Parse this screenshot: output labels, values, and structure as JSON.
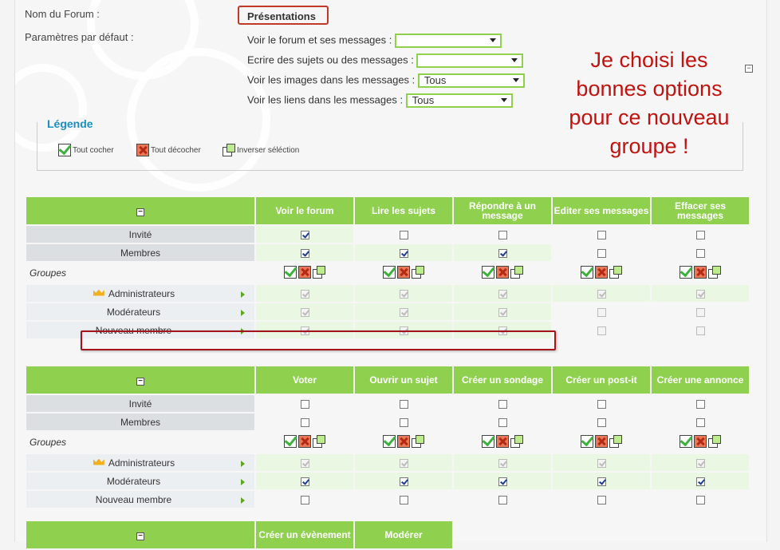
{
  "colors": {
    "accent": "#8fd14f",
    "annotation": "#c0120f",
    "legend_title": "#1a8fc4"
  },
  "form": {
    "forum_name_label": "Nom du Forum :",
    "forum_name_value": "Présentations",
    "defaults_label": "Paramètres par défaut :",
    "opt_view": {
      "label": "Voir le forum et ses messages :",
      "value": ""
    },
    "opt_write": {
      "label": "Ecrire des sujets ou des messages :",
      "value": ""
    },
    "opt_images": {
      "label": "Voir les images dans les messages :",
      "value": "Tous"
    },
    "opt_links": {
      "label": "Voir les liens dans les messages :",
      "value": "Tous"
    }
  },
  "annotation": [
    "Je choisi les",
    "bonnes options",
    "pour ce nouveau",
    "groupe !"
  ],
  "legend": {
    "title": "Légende",
    "check_all": "Tout cocher",
    "uncheck_all": "Tout décocher",
    "invert": "Inverser séléction"
  },
  "collapse_symbol": "−",
  "rows": {
    "invite": "Invité",
    "membres": "Membres",
    "groupes": "Groupes",
    "admins": "Administrateurs",
    "mods": "Modérateurs",
    "nouveau": "Nouveau membre"
  },
  "table1": {
    "headers": [
      "Voir le forum",
      "Lire les sujets",
      "Répondre à un message",
      "Editer ses messages",
      "Effacer ses messages"
    ],
    "invite": [
      true,
      false,
      false,
      false,
      false
    ],
    "membres": [
      true,
      true,
      true,
      false,
      false
    ],
    "admins": [
      true,
      true,
      true,
      true,
      true
    ],
    "mods": [
      true,
      true,
      true,
      false,
      false
    ],
    "nouveau": [
      true,
      true,
      true,
      false,
      false
    ]
  },
  "table2": {
    "headers": [
      "Voter",
      "Ouvrir un sujet",
      "Créer un sondage",
      "Créer un post-it",
      "Créer une annonce"
    ],
    "invite": [
      false,
      false,
      false,
      false,
      false
    ],
    "membres": [
      false,
      false,
      false,
      false,
      false
    ],
    "admins": [
      true,
      true,
      true,
      true,
      true
    ],
    "mods": [
      true,
      true,
      true,
      true,
      true
    ],
    "nouveau": [
      false,
      false,
      false,
      false,
      false
    ]
  },
  "table3": {
    "headers": [
      "Créer un évènement",
      "Modérer"
    ]
  }
}
